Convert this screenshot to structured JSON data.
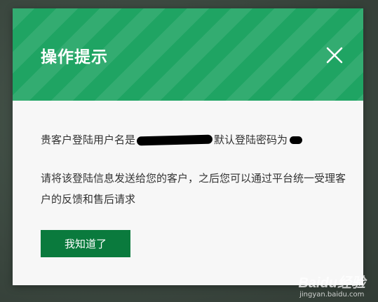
{
  "dialog": {
    "title": "操作提示",
    "close_icon": "close-icon",
    "body": {
      "line1_prefix": "贵客户登陆用户名是",
      "line1_middle": "默认登陆密码为",
      "paragraph2": "请将该登陆信息发送给您的客户，之后您可以通过平台统一受理客户的反馈和售后请求"
    },
    "confirm_label": "我知道了"
  },
  "watermark": {
    "logo": "Baidu经验",
    "site": "jingyan.baidu.com"
  },
  "colors": {
    "header_green": "#1fa463",
    "button_green": "#0a7a3d",
    "backdrop": "#3c4a41"
  }
}
